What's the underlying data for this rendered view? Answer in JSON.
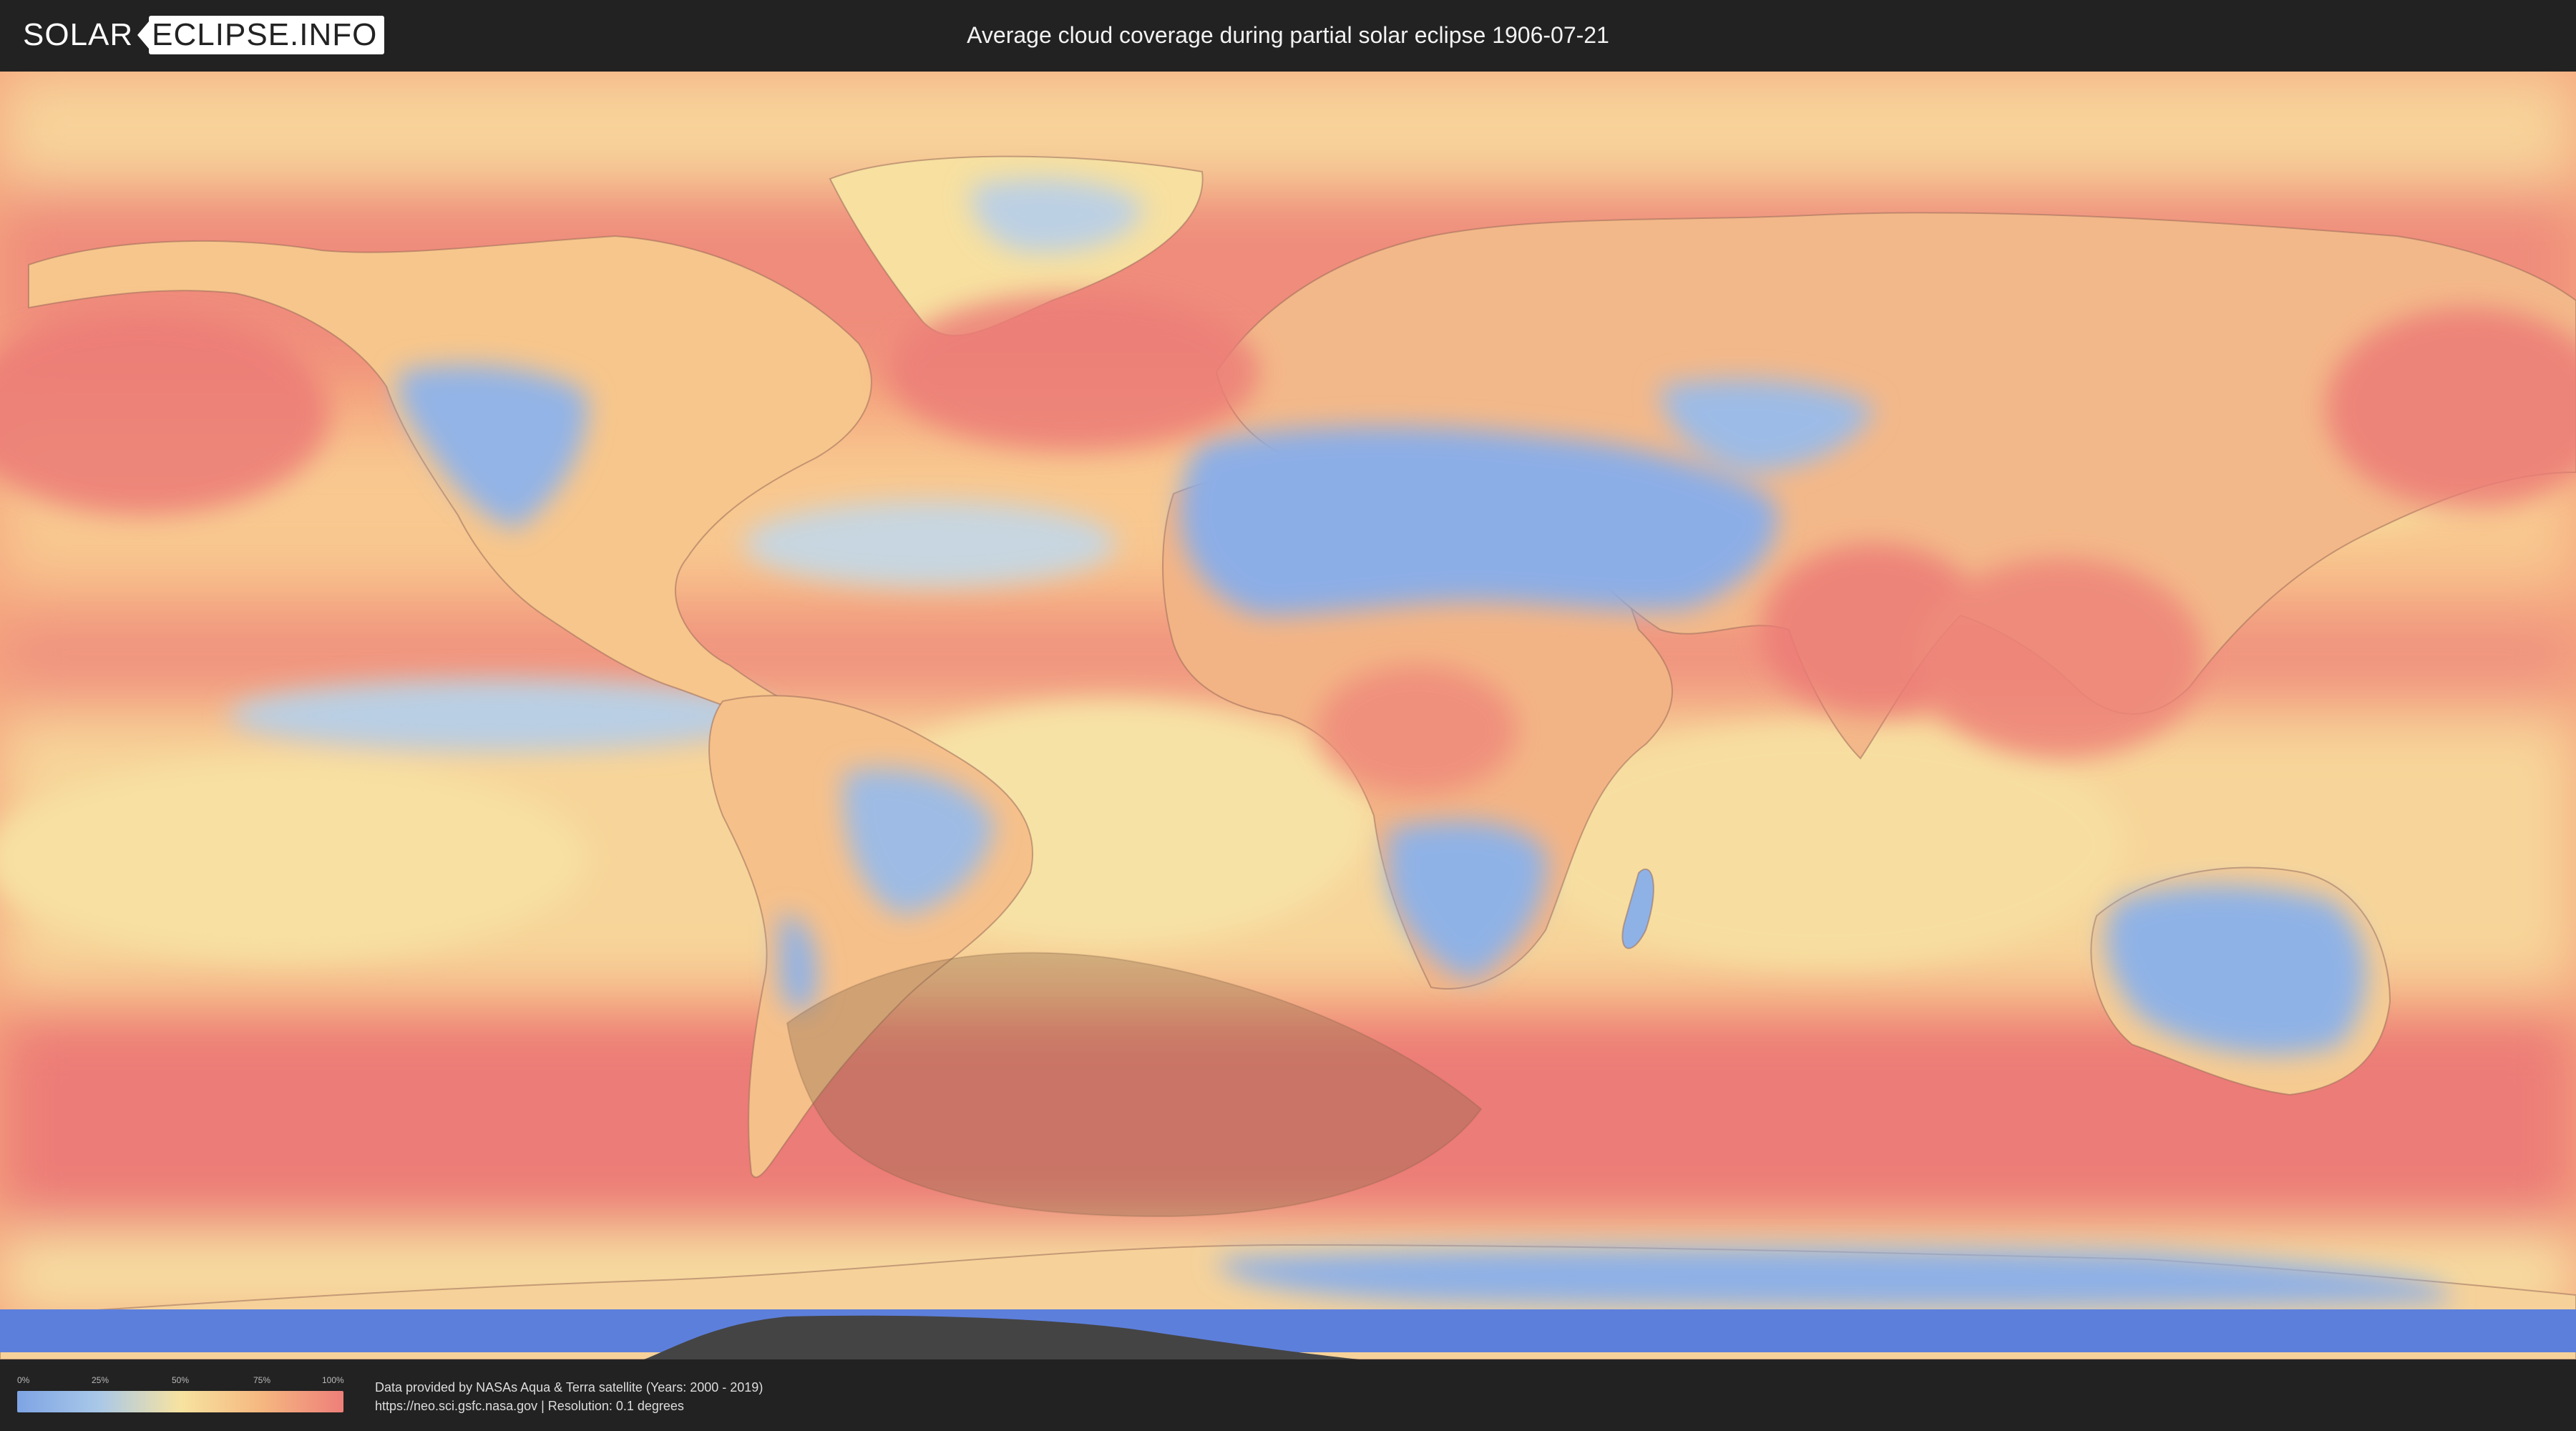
{
  "header": {
    "logo_left": "SOLAR",
    "logo_right": "ECLIPSE.INFO",
    "title": "Average cloud coverage during partial solar eclipse 1906-07-21"
  },
  "legend": {
    "ticks": [
      "0%",
      "25%",
      "50%",
      "75%",
      "100%"
    ],
    "colors": [
      "#7ea4e4",
      "#a9c8e8",
      "#f7e3a0",
      "#f5b780",
      "#ee7f7a"
    ]
  },
  "credits": {
    "line1": "Data provided by NASAs Aqua & Terra satellite (Years: 2000 - 2019)",
    "line2": "https://neo.sci.gsfc.nasa.gov | Resolution: 0.1 degrees"
  },
  "map": {
    "colors": {
      "ocean": "#f5a67e",
      "cloudy": "#ec7d78",
      "medium": "#f8cb8e",
      "light": "#f7e2a3",
      "clear": "#8fb2e6",
      "clear_dark": "#6f95e0",
      "antarctic": "#5d7fdc",
      "eclipse": "#8a6848",
      "coast": "#9a6c5a"
    },
    "eclipse_zone": "partial solar eclipse visibility area"
  }
}
